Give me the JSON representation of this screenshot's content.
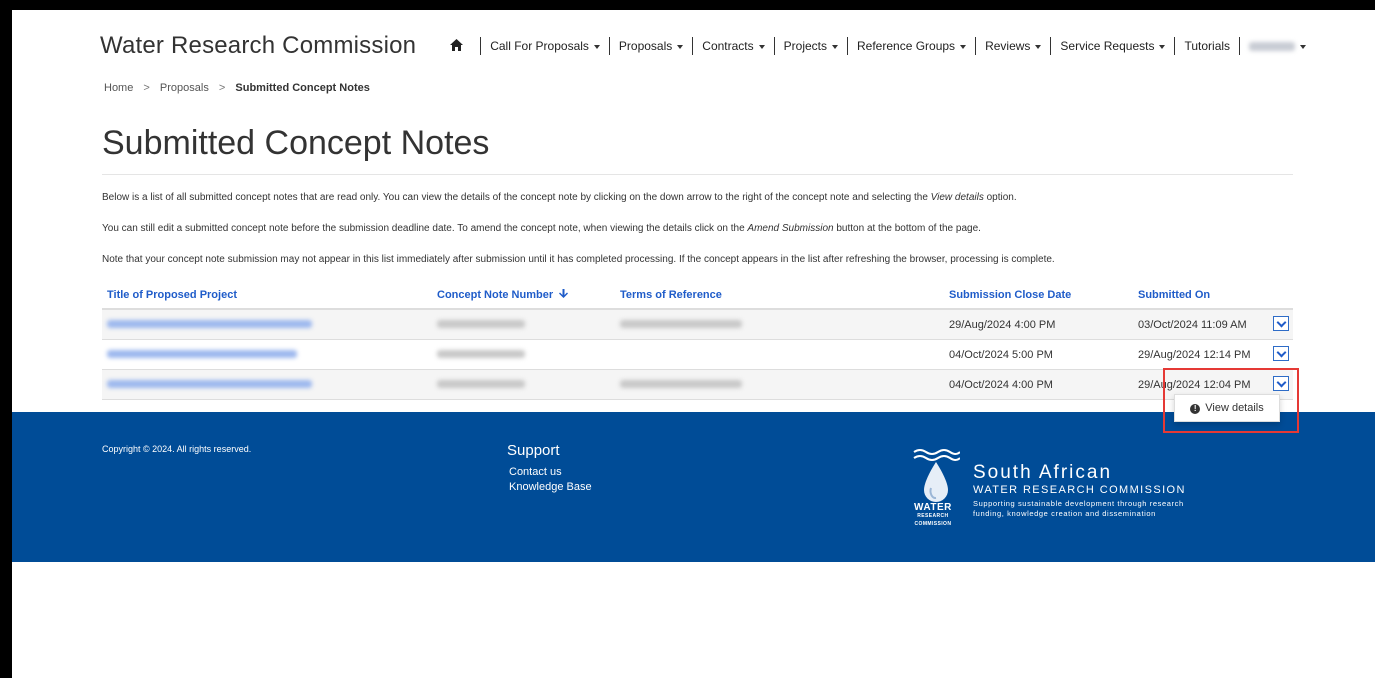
{
  "navbar": {
    "brand": "Water Research Commission",
    "items": [
      {
        "label": "Call For Proposals",
        "dropdown": true
      },
      {
        "label": "Proposals",
        "dropdown": true
      },
      {
        "label": "Contracts",
        "dropdown": true
      },
      {
        "label": "Projects",
        "dropdown": true
      },
      {
        "label": "Reference Groups",
        "dropdown": true
      },
      {
        "label": "Reviews",
        "dropdown": true
      },
      {
        "label": "Service Requests",
        "dropdown": true
      },
      {
        "label": "Tutorials",
        "dropdown": false
      }
    ],
    "home_icon": "home-icon"
  },
  "breadcrumb": {
    "home": "Home",
    "proposals": "Proposals",
    "current": "Submitted Concept Notes",
    "separator": ">"
  },
  "page_title": "Submitted Concept Notes",
  "intro": {
    "p1_a": "Below is a list of all submitted concept notes that are read only.  You can view the details of the concept note by clicking on the down arrow to the right of the concept note and selecting the ",
    "p1_em": "View details",
    "p1_b": " option.",
    "p2_a": "You can still edit a submitted concept note before the submission deadline date. To amend the concept note, when viewing the details click on the ",
    "p2_em": "Amend Submission",
    "p2_b": " button at the bottom of the page.",
    "p3": "Note that your concept note submission may not appear in this list immediately after submission until it has completed processing. If the concept appears in the list after refreshing the browser, processing is complete."
  },
  "table": {
    "headers": {
      "title": "Title of Proposed Project",
      "number": "Concept Note Number",
      "terms": "Terms of Reference",
      "close_date": "Submission Close Date",
      "submitted_on": "Submitted On"
    },
    "sort_icon": "arrow-down-icon",
    "rows": [
      {
        "close_date": "29/Aug/2024 4:00 PM",
        "submitted_on": "03/Oct/2024 11:09 AM",
        "has_terms": true
      },
      {
        "close_date": "04/Oct/2024 5:00 PM",
        "submitted_on": "29/Aug/2024 12:14 PM",
        "has_terms": false
      },
      {
        "close_date": "04/Oct/2024 4:00 PM",
        "submitted_on": "29/Aug/2024 12:04 PM",
        "has_terms": true
      }
    ]
  },
  "dropdown_menu": {
    "view_details": "View details",
    "icon": "info-circle-icon"
  },
  "footer": {
    "copyright": "Copyright © 2024. All rights reserved.",
    "support_heading": "Support",
    "links": [
      "Contact us",
      "Knowledge Base"
    ],
    "logo": {
      "title": "South African",
      "subtitle": "WATER RESEARCH COMMISSION",
      "tagline1": "Supporting sustainable development through research",
      "tagline2": "funding, knowledge creation and dissemination",
      "badge_line1": "WATER",
      "badge_line2": "RESEARCH",
      "badge_line3": "COMMISSION"
    }
  },
  "colors": {
    "link": "#1f5cc9",
    "footer_bg": "#004c97",
    "highlight": "#e53935"
  }
}
